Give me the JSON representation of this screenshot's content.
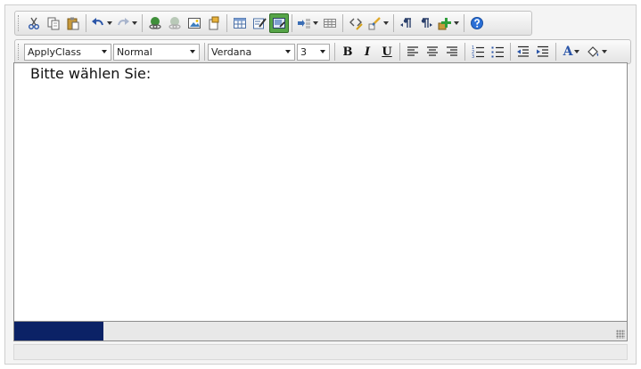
{
  "toolbar1": {
    "buttons": [
      {
        "name": "cut",
        "icon": "scissors-icon"
      },
      {
        "name": "copy",
        "icon": "copy-icon"
      },
      {
        "name": "paste",
        "icon": "clipboard-icon"
      },
      {
        "name": "undo",
        "icon": "undo-icon"
      },
      {
        "name": "redo",
        "icon": "redo-icon"
      },
      {
        "name": "hyperlink",
        "icon": "link-icon"
      },
      {
        "name": "remove-link",
        "icon": "unlink-icon"
      },
      {
        "name": "image-manager",
        "icon": "image-icon"
      },
      {
        "name": "document-manager",
        "icon": "document-icon"
      },
      {
        "name": "insert-table",
        "icon": "table-icon"
      },
      {
        "name": "form-element",
        "icon": "form-edit-icon"
      },
      {
        "name": "selected-tool",
        "icon": "image-edit-icon",
        "active": true
      },
      {
        "name": "insert-field",
        "icon": "insert-field-icon"
      },
      {
        "name": "grid",
        "icon": "grid-icon"
      },
      {
        "name": "html-snippet",
        "icon": "tag-icon"
      },
      {
        "name": "format-stripper",
        "icon": "brush-icon"
      },
      {
        "name": "paragraph-ltr",
        "icon": "pilcrow-left-icon"
      },
      {
        "name": "paragraph-rtl",
        "icon": "pilcrow-right-icon"
      },
      {
        "name": "custom-plugin",
        "icon": "plus-icon"
      },
      {
        "name": "help",
        "icon": "help-icon"
      }
    ]
  },
  "toolbar2": {
    "apply_class": "ApplyClass",
    "paragraph_style": "Normal",
    "font_name": "Verdana",
    "font_size": "3",
    "bold_label": "B",
    "italic_label": "I",
    "underline_label": "U",
    "text_color_label": "A"
  },
  "editor": {
    "content": "Bitte wählen Sie:"
  },
  "status": {
    "progress_fraction": 0.145,
    "progress_color": "#0b2266"
  },
  "colors": {
    "accent_active": "#56a447",
    "help_blue": "#2a6fd6"
  }
}
